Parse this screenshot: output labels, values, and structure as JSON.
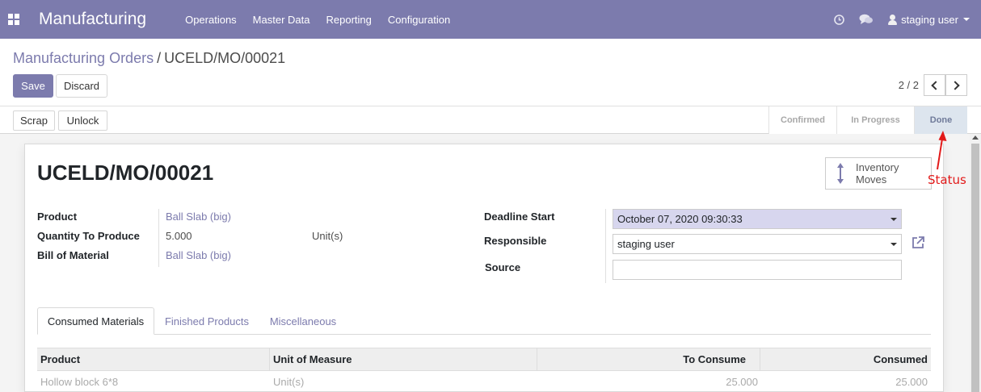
{
  "navbar": {
    "brand": "Manufacturing",
    "menu": [
      "Operations",
      "Master Data",
      "Reporting",
      "Configuration"
    ],
    "user": "staging user",
    "bg_color": "#7c7bad"
  },
  "breadcrumb": {
    "parent": "Manufacturing Orders",
    "separator": "/",
    "current": "UCELD/MO/00021"
  },
  "buttons": {
    "save": "Save",
    "discard": "Discard",
    "scrap": "Scrap",
    "unlock": "Unlock"
  },
  "pager": {
    "value": "2 / 2"
  },
  "statusbar": {
    "stages": [
      "Confirmed",
      "In Progress",
      "Done"
    ],
    "active": "Done"
  },
  "record": {
    "name": "UCELD/MO/00021",
    "smart_button": {
      "line1": "Inventory",
      "line2": "Moves",
      "icon": "up-down-arrow-icon"
    }
  },
  "annotation": {
    "label": "Status",
    "color": "#e21a1a"
  },
  "fields": {
    "product_label": "Product",
    "product_value": "Ball Slab (big)",
    "qty_label": "Quantity To Produce",
    "qty_value": "5.000",
    "qty_uom": "Unit(s)",
    "bom_label": "Bill of Material",
    "bom_value": "Ball Slab (big)",
    "deadline_label": "Deadline Start",
    "deadline_value": "October 07, 2020 09:30:33",
    "responsible_label": "Responsible",
    "responsible_value": "staging user",
    "source_label": "Source",
    "source_value": ""
  },
  "tabs": [
    "Consumed Materials",
    "Finished Products",
    "Miscellaneous"
  ],
  "table": {
    "headers": [
      "Product",
      "Unit of Measure",
      "To Consume",
      "Consumed"
    ],
    "rows": [
      [
        "Hollow block 6*8",
        "Unit(s)",
        "25.000",
        "25.000"
      ]
    ]
  }
}
